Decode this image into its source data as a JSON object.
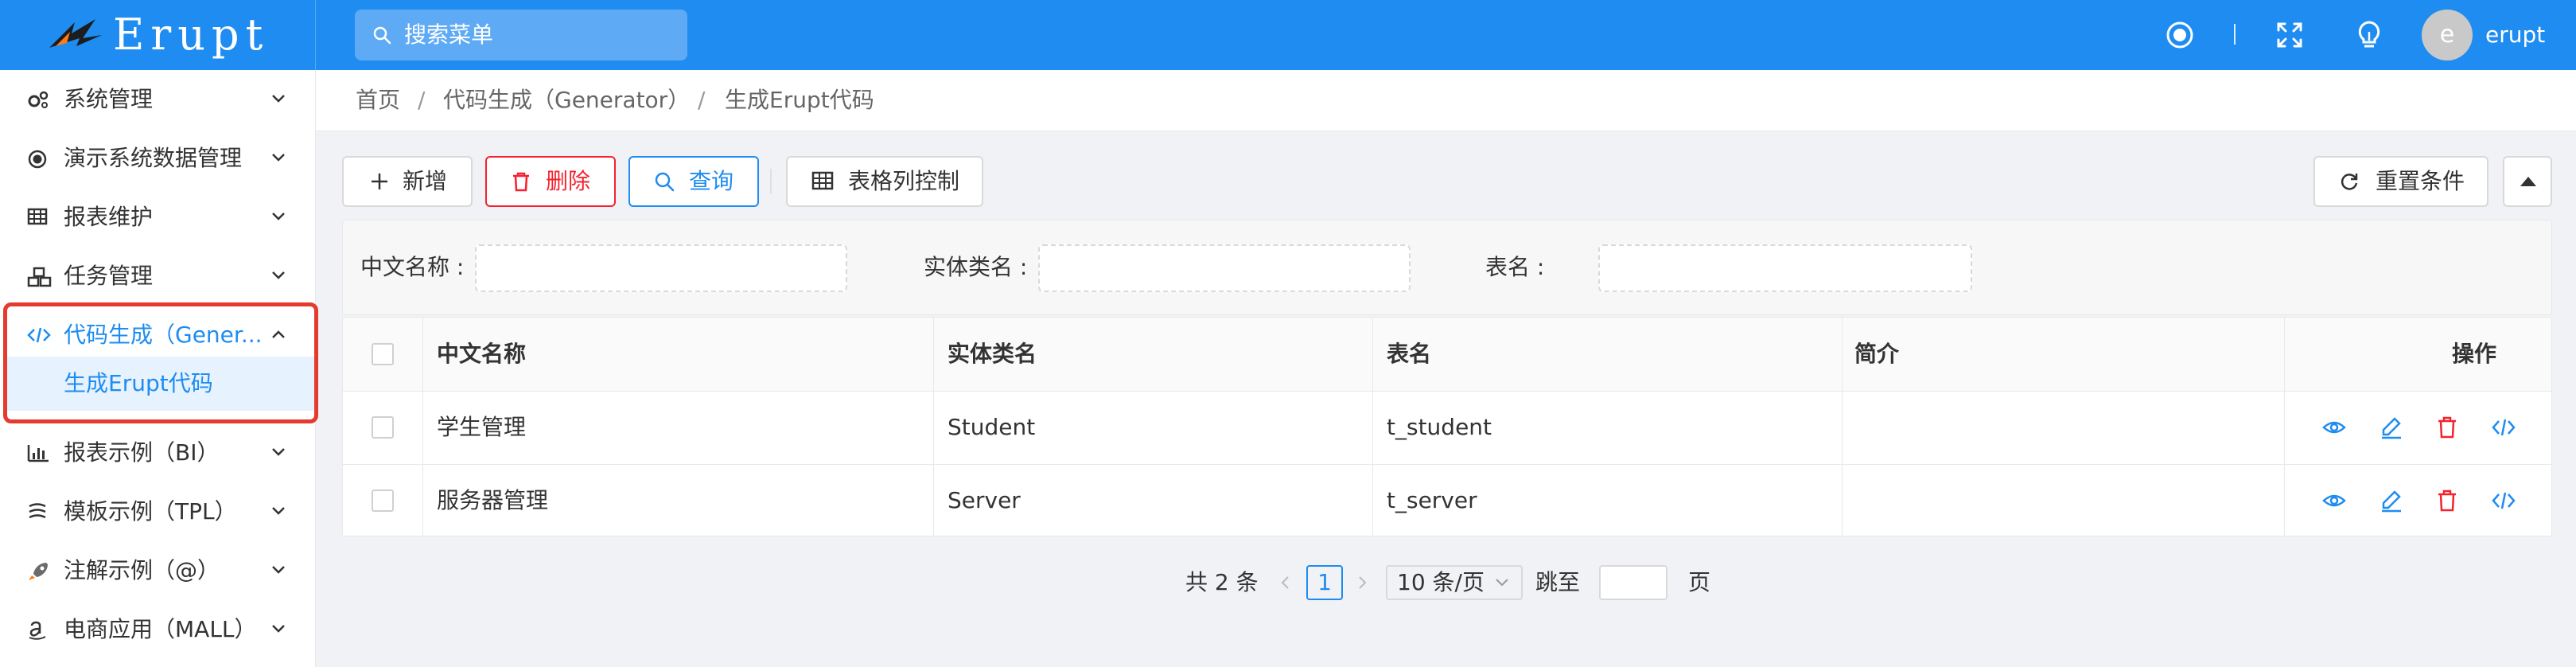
{
  "header": {
    "logo_text": "Erupt",
    "search_placeholder": "搜索菜单",
    "user_initial": "e",
    "user_name": "erupt"
  },
  "sidebar": {
    "items": [
      {
        "label": "系统管理",
        "icon": "gears-icon"
      },
      {
        "label": "演示系统数据管理",
        "icon": "record-icon"
      },
      {
        "label": "报表维护",
        "icon": "table-icon"
      },
      {
        "label": "任务管理",
        "icon": "cubes-icon"
      },
      {
        "label": "代码生成（Gener...",
        "icon": "code-icon",
        "active": true
      },
      {
        "label": "报表示例（BI）",
        "icon": "bar-chart-icon"
      },
      {
        "label": "模板示例（TPL）",
        "icon": "template-icon"
      },
      {
        "label": "注解示例（@）",
        "icon": "rocket-icon"
      },
      {
        "label": "电商应用（MALL）",
        "icon": "amazon-icon"
      }
    ],
    "submenu": {
      "label": "生成Erupt代码"
    }
  },
  "breadcrumb": [
    "首页",
    "代码生成（Generator）",
    "生成Erupt代码"
  ],
  "toolbar": {
    "add_label": "新增",
    "delete_label": "删除",
    "search_label": "查询",
    "columns_label": "表格列控制",
    "reset_label": "重置条件"
  },
  "filters": {
    "cn_name_label": "中文名称 :",
    "class_name_label": "实体类名 :",
    "table_name_label": "表名 :"
  },
  "table": {
    "columns": [
      "中文名称",
      "实体类名",
      "表名",
      "简介",
      "操作"
    ],
    "rows": [
      {
        "cn_name": "学生管理",
        "class_name": "Student",
        "table_name": "t_student",
        "desc": ""
      },
      {
        "cn_name": "服务器管理",
        "class_name": "Server",
        "table_name": "t_server",
        "desc": ""
      }
    ]
  },
  "pagination": {
    "total": "共 2 条",
    "current_page": "1",
    "page_size": "10 条/页",
    "jump_label": "跳至",
    "page_suffix": "页"
  },
  "colors": {
    "primary": "#1e8cf0",
    "danger": "#f5222d",
    "highlight": "#e43a2f"
  }
}
